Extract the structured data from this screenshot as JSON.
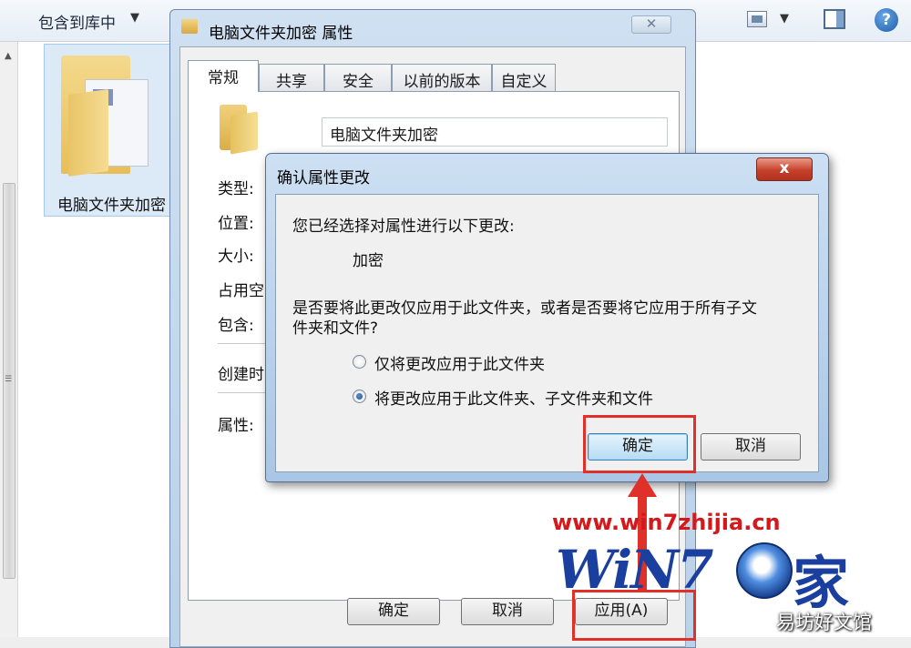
{
  "explorer": {
    "toolbar_library": "包含到库中",
    "folder_name": "电脑文件夹加密"
  },
  "properties_dialog": {
    "title": "电脑文件夹加密 属性",
    "tabs": [
      "常规",
      "共享",
      "安全",
      "以前的版本",
      "自定义"
    ],
    "active_tab": "常规",
    "folder_name_value": "电脑文件夹加密",
    "labels": {
      "type": "类型:",
      "location": "位置:",
      "size": "大小:",
      "size_on_disk": "占用空间",
      "contains": "包含:",
      "created": "创建时间",
      "attributes": "属性:"
    },
    "buttons": {
      "ok": "确定",
      "cancel": "取消",
      "apply": "应用(A)"
    }
  },
  "confirm_dialog": {
    "title": "确认属性更改",
    "close_label": "x",
    "intro": "您已经选择对属性进行以下更改:",
    "change": "加密",
    "question_line1": "是否要将此更改仅应用于此文件夹，或者是否要将它应用于所有子文",
    "question_line2": "件夹和文件?",
    "options": [
      {
        "label": "仅将更改应用于此文件夹",
        "selected": false
      },
      {
        "label": "将更改应用于此文件夹、子文件夹和文件",
        "selected": true
      }
    ],
    "buttons": {
      "ok": "确定",
      "cancel": "取消"
    }
  },
  "annotations": {
    "highlight_color": "#e0302a"
  },
  "watermark": {
    "url": "www.win7zhijia.cn",
    "logo_text": "WiN7",
    "logo_suffix": "家",
    "brand": "易坊好文馆"
  }
}
